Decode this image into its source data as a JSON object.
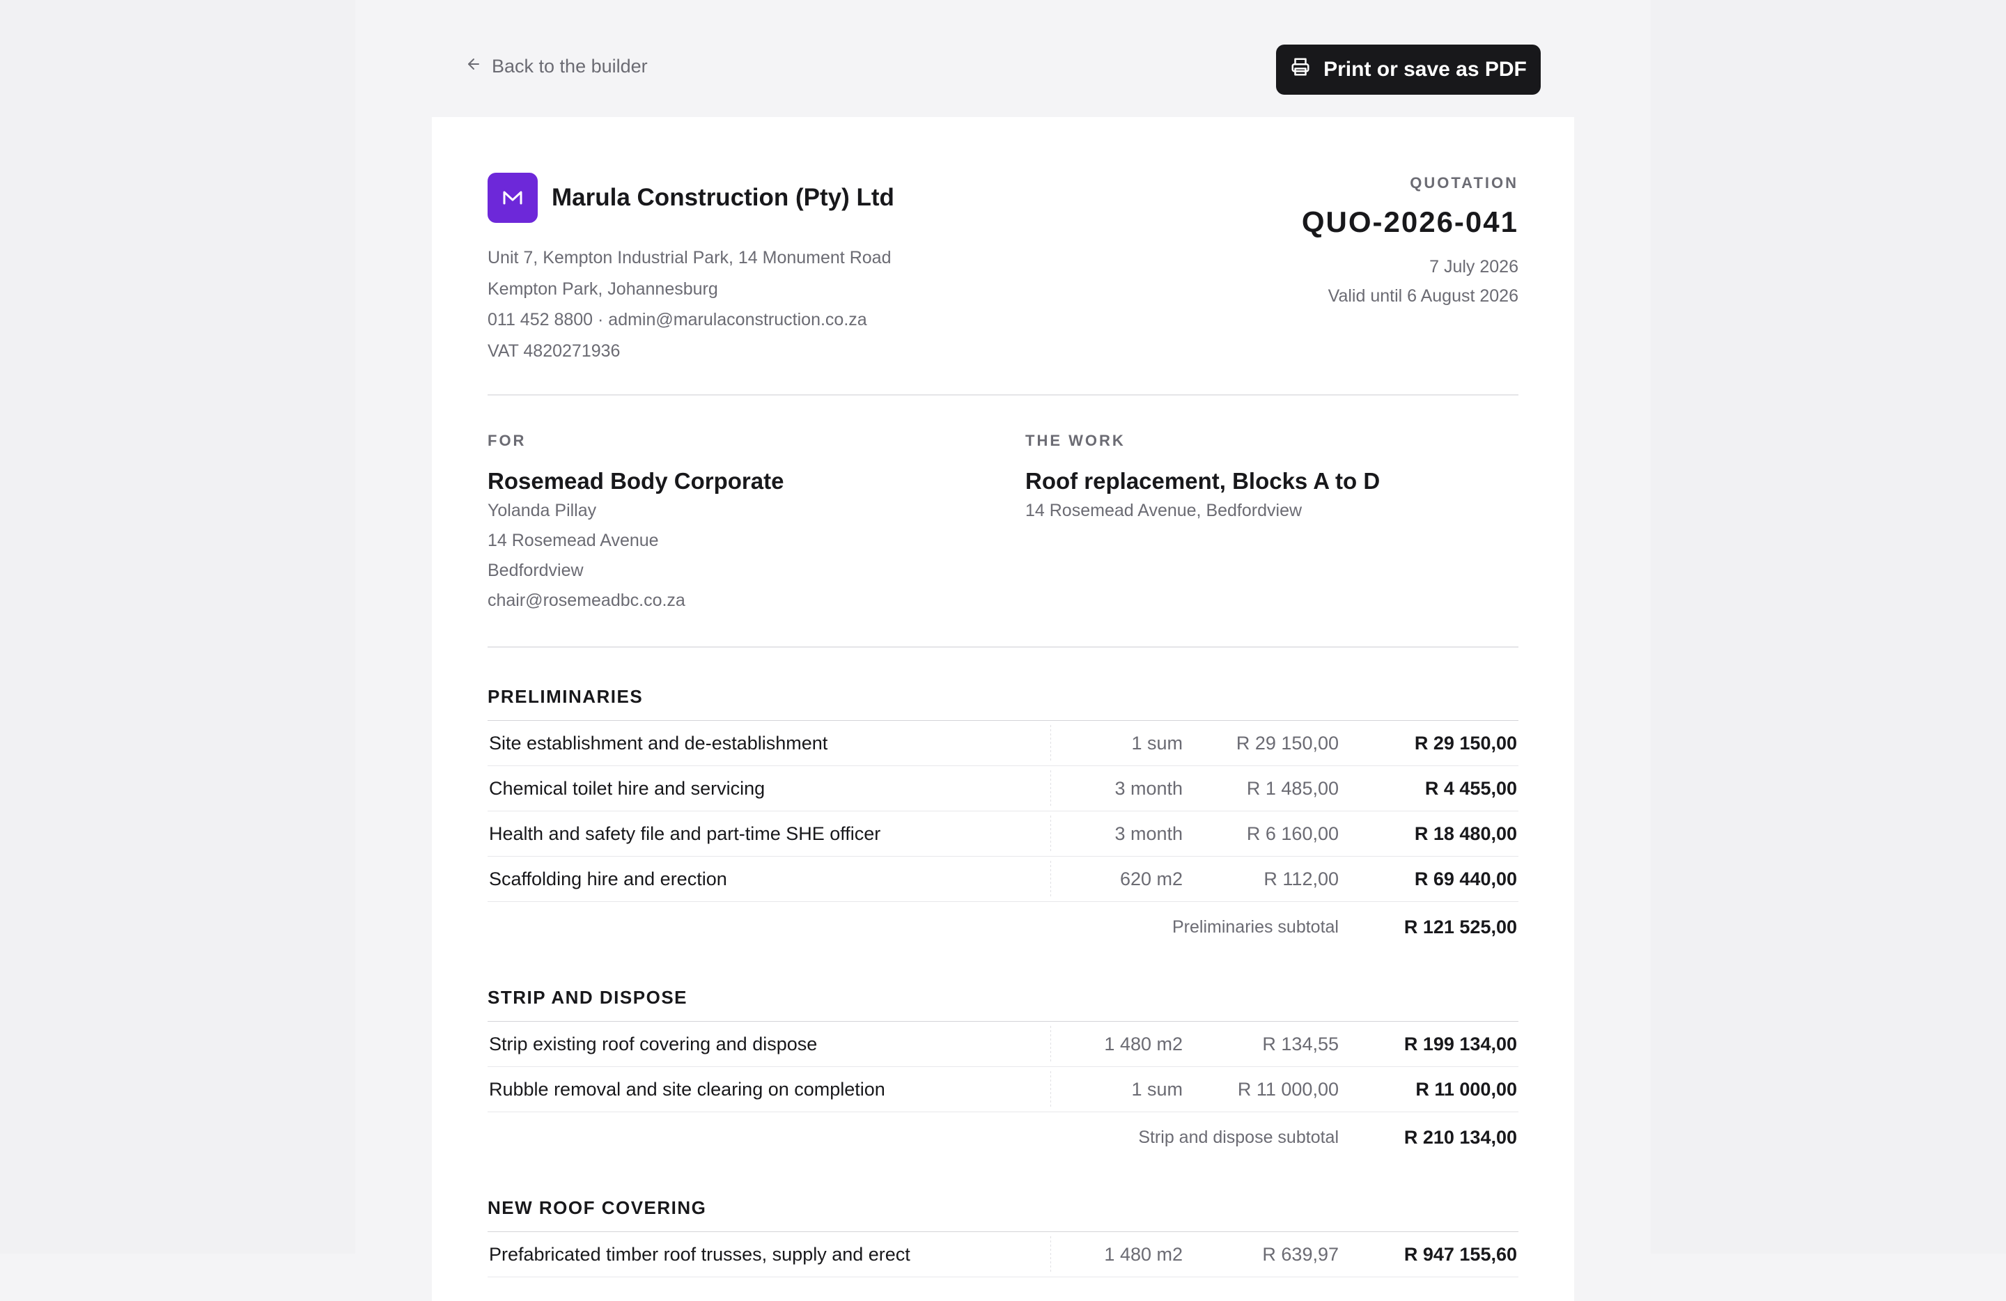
{
  "topbar": {
    "back_label": "Back to the builder",
    "print_label": "Print or save as PDF"
  },
  "company": {
    "name": "Marula Construction (Pty) Ltd",
    "address_line_1": "Unit 7, Kempton Industrial Park, 14 Monument Road",
    "address_line_2": "Kempton Park, Johannesburg",
    "contact": "011 452 8800 · admin@marulaconstruction.co.za",
    "vat": "VAT 4820271936",
    "logo_color": "#6d28d9"
  },
  "quote": {
    "label": "QUOTATION",
    "number": "QUO-2026-041",
    "date": "7 July 2026",
    "valid_until": "Valid until 6 August 2026"
  },
  "client": {
    "label": "FOR",
    "name": "Rosemead Body Corporate",
    "contact_person": "Yolanda Pillay",
    "street": "14 Rosemead Avenue",
    "suburb": "Bedfordview",
    "email": "chair@rosemeadbc.co.za"
  },
  "work": {
    "label": "THE WORK",
    "title": "Roof replacement, Blocks A to D",
    "location": "14 Rosemead Avenue, Bedfordview"
  },
  "sections": [
    {
      "title": "PRELIMINARIES",
      "items": [
        {
          "desc": "Site establishment and de-establishment",
          "qty": "1 sum",
          "rate": "R 29 150,00",
          "amount": "R 29 150,00"
        },
        {
          "desc": "Chemical toilet hire and servicing",
          "qty": "3 month",
          "rate": "R 1 485,00",
          "amount": "R 4 455,00"
        },
        {
          "desc": "Health and safety file and part-time SHE officer",
          "qty": "3 month",
          "rate": "R 6 160,00",
          "amount": "R 18 480,00"
        },
        {
          "desc": "Scaffolding hire and erection",
          "qty": "620 m2",
          "rate": "R 112,00",
          "amount": "R 69 440,00"
        }
      ],
      "subtotal_label": "Preliminaries subtotal",
      "subtotal_value": "R 121 525,00"
    },
    {
      "title": "STRIP AND DISPOSE",
      "items": [
        {
          "desc": "Strip existing roof covering and dispose",
          "qty": "1 480 m2",
          "rate": "R 134,55",
          "amount": "R 199 134,00"
        },
        {
          "desc": "Rubble removal and site clearing on completion",
          "qty": "1 sum",
          "rate": "R 11 000,00",
          "amount": "R 11 000,00"
        }
      ],
      "subtotal_label": "Strip and dispose subtotal",
      "subtotal_value": "R 210 134,00"
    },
    {
      "title": "NEW ROOF COVERING",
      "items": [
        {
          "desc": "Prefabricated timber roof trusses, supply and erect",
          "qty": "1 480 m2",
          "rate": "R 639,97",
          "amount": "R 947 155,60"
        }
      ]
    }
  ]
}
